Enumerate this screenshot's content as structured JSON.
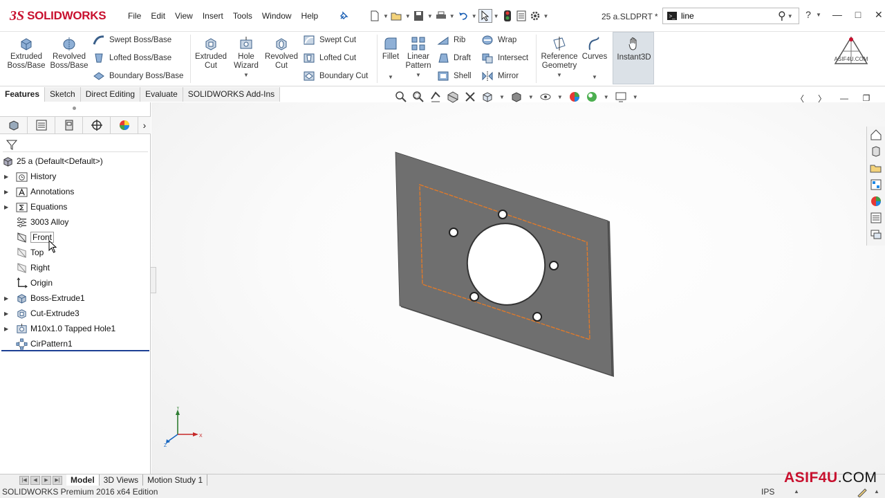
{
  "app": {
    "name": "SOLIDWORKS",
    "logo_mark": "3S"
  },
  "menu": [
    "File",
    "Edit",
    "View",
    "Insert",
    "Tools",
    "Window",
    "Help"
  ],
  "document_title": "25 a.SLDPRT *",
  "search": {
    "value": "line"
  },
  "command_manager": {
    "extruded_boss": "Extruded Boss/Base",
    "revolved_boss": "Revolved Boss/Base",
    "swept_boss": "Swept Boss/Base",
    "lofted_boss": "Lofted Boss/Base",
    "boundary_boss": "Boundary Boss/Base",
    "extruded_cut": "Extruded Cut",
    "hole_wizard": "Hole Wizard",
    "revolved_cut": "Revolved Cut",
    "swept_cut": "Swept Cut",
    "lofted_cut": "Lofted Cut",
    "boundary_cut": "Boundary Cut",
    "fillet": "Fillet",
    "linear_pattern": "Linear Pattern",
    "rib": "Rib",
    "draft": "Draft",
    "shell": "Shell",
    "wrap": "Wrap",
    "intersect": "Intersect",
    "mirror": "Mirror",
    "reference_geometry": "Reference Geometry",
    "curves": "Curves",
    "instant3d": "Instant3D"
  },
  "tabs": [
    "Features",
    "Sketch",
    "Direct Editing",
    "Evaluate",
    "SOLIDWORKS Add-Ins"
  ],
  "feature_tree": {
    "root": "25 a  (Default<Default>)",
    "items": [
      {
        "label": "History",
        "icon": "history-folder-icon",
        "expandable": true
      },
      {
        "label": "Annotations",
        "icon": "annotations-icon",
        "expandable": true
      },
      {
        "label": "Equations",
        "icon": "equations-icon",
        "expandable": true
      },
      {
        "label": "3003 Alloy",
        "icon": "material-icon",
        "expandable": false
      },
      {
        "label": "Front",
        "icon": "plane-icon",
        "expandable": false,
        "selected": true
      },
      {
        "label": "Top",
        "icon": "plane-icon",
        "expandable": false
      },
      {
        "label": "Right",
        "icon": "plane-icon",
        "expandable": false
      },
      {
        "label": "Origin",
        "icon": "origin-icon",
        "expandable": false
      },
      {
        "label": "Boss-Extrude1",
        "icon": "boss-extrude-icon",
        "expandable": true
      },
      {
        "label": "Cut-Extrude3",
        "icon": "cut-extrude-icon",
        "expandable": true
      },
      {
        "label": "M10x1.0 Tapped Hole1",
        "icon": "hole-icon",
        "expandable": true
      },
      {
        "label": "CirPattern1",
        "icon": "circular-pattern-icon",
        "expandable": false
      }
    ]
  },
  "bottom_tabs": [
    "Model",
    "3D Views",
    "Motion Study 1"
  ],
  "status": {
    "edition": "SOLIDWORKS Premium 2016 x64 Edition",
    "units": "IPS"
  },
  "watermark": {
    "name": "ASIF4U",
    "tld": ".COM",
    "logo_text": "ASIF4U.COM"
  },
  "colors": {
    "brand": "#c8102e",
    "part_face": "#707070",
    "sketch_highlight": "#e07a2a",
    "selection_blue": "#1c3f94"
  }
}
